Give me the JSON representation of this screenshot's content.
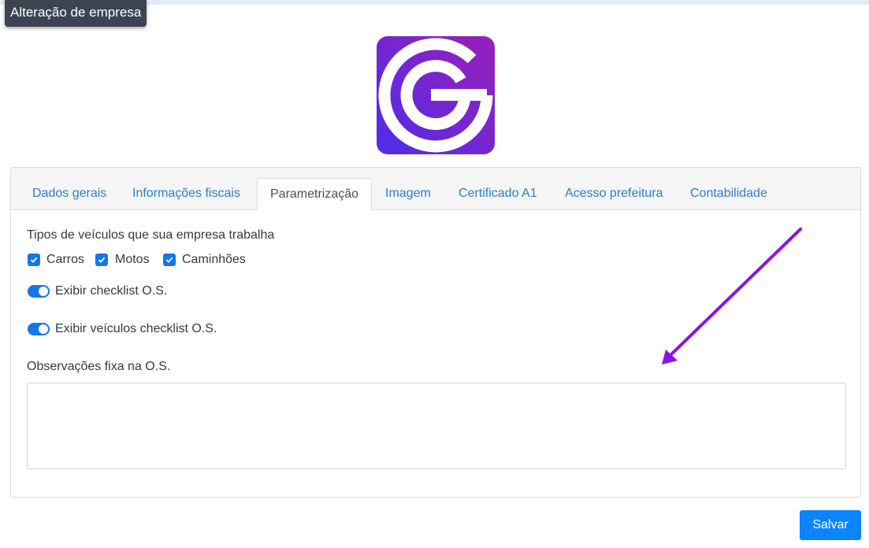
{
  "window": {
    "title": "Alteração de empresa"
  },
  "logo": {
    "icon": "g-logo-icon",
    "gradient_start": "#9a1fb8",
    "gradient_end": "#4f2ee8"
  },
  "tabs": [
    {
      "label": "Dados gerais",
      "active": false
    },
    {
      "label": "Informações fiscais",
      "active": false
    },
    {
      "label": "Parametrização",
      "active": true
    },
    {
      "label": "Imagem",
      "active": false
    },
    {
      "label": "Certificado A1",
      "active": false
    },
    {
      "label": "Acesso prefeitura",
      "active": false
    },
    {
      "label": "Contabilidade",
      "active": false
    }
  ],
  "vehicle_types": {
    "label": "Tipos de veículos que sua empresa trabalha",
    "options": [
      {
        "label": "Carros",
        "checked": true
      },
      {
        "label": "Motos",
        "checked": true
      },
      {
        "label": "Caminhões",
        "checked": true
      }
    ]
  },
  "toggles": [
    {
      "label": "Exibir checklist O.S.",
      "on": true
    },
    {
      "label": "Exibir veículos checklist O.S.",
      "on": true
    }
  ],
  "observations": {
    "label": "Observações fixa na O.S.",
    "value": ""
  },
  "annotation": {
    "arrow_color": "#8a12e8"
  },
  "actions": {
    "save_label": "Salvar"
  },
  "colors": {
    "primary": "#0d84ff",
    "tab_link": "#2b7cd3",
    "control_on": "#1577e8"
  }
}
